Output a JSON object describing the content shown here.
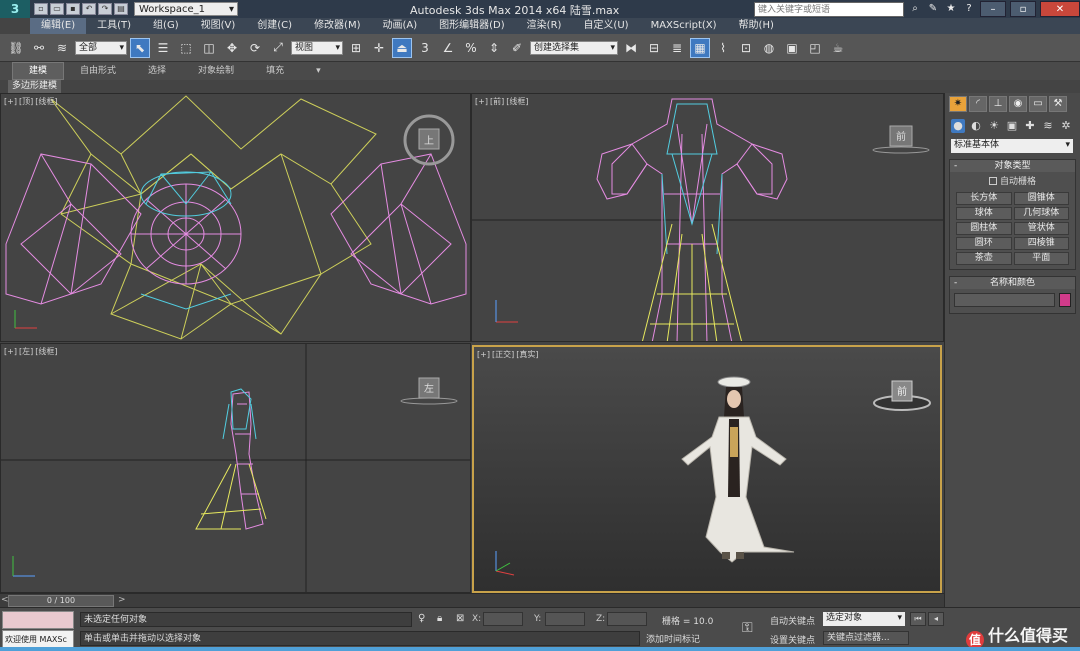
{
  "titlebar": {
    "workspace": "Workspace_1",
    "title": "Autodesk 3ds Max  2014 x64     陆雪.max",
    "search_placeholder": "键入关键字或短语"
  },
  "menu": [
    "编辑(E)",
    "工具(T)",
    "组(G)",
    "视图(V)",
    "创建(C)",
    "修改器(M)",
    "动画(A)",
    "图形编辑器(D)",
    "渲染(R)",
    "自定义(U)",
    "MAXScript(X)",
    "帮助(H)"
  ],
  "toolbar": {
    "selection_filter": "全部",
    "ref_coord": "视图",
    "named_selection": "创建选择集"
  },
  "ribbon": {
    "tabs": [
      "建模",
      "自由形式",
      "选择",
      "对象绘制",
      "填充"
    ],
    "sub_label": "多边形建模"
  },
  "viewports": {
    "top": {
      "labels": [
        "[+]",
        "[顶]",
        "[线框]"
      ],
      "cube": "上"
    },
    "front": {
      "labels": [
        "[+]",
        "[前]",
        "[线框]"
      ],
      "cube": "前"
    },
    "left": {
      "labels": [
        "[+]",
        "[左]",
        "[线框]"
      ],
      "cube": "左"
    },
    "persp": {
      "labels": [
        "[+]",
        "[正交]",
        "[真实]"
      ],
      "cube": "前"
    }
  },
  "command_panel": {
    "category": "标准基本体",
    "rollout_object_type": "对象类型",
    "auto_grid": "自动栅格",
    "objects": [
      "长方体",
      "圆锥体",
      "球体",
      "几何球体",
      "圆柱体",
      "管状体",
      "圆环",
      "四棱锥",
      "茶壶",
      "平面"
    ],
    "rollout_name_color": "名称和颜色",
    "object_color": "#d13b8a"
  },
  "timeslider": {
    "value": "0 / 100",
    "left_arrow": "<",
    "right_arrow": ">"
  },
  "statusbar": {
    "welcome": "欢迎使用 MAXSc",
    "status_text": "未选定任何对象",
    "prompt_text": "单击或单击并拖动以选择对象",
    "x_label": "X:",
    "y_label": "Y:",
    "z_label": "Z:",
    "grid": "栅格 = 10.0",
    "add_time_tag": "添加时间标记",
    "auto_key": "自动关键点",
    "set_key": "设置关键点",
    "key_mode": "选定对象",
    "key_filters": "关键点过滤器...",
    "watermark": "什么值得买"
  }
}
